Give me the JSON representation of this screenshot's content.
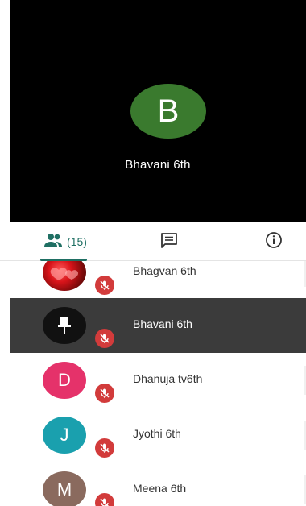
{
  "stage": {
    "avatar_letter": "B",
    "avatar_color": "#3a7a2e",
    "name": "Bhavani 6th"
  },
  "tabs": {
    "people_count": "(15)",
    "active": "people",
    "accent_color": "#1f6f63",
    "icons": [
      "people-icon",
      "chat-icon",
      "info-icon"
    ]
  },
  "participants": [
    {
      "name": "Bhagvan 6th",
      "avatar": "photo",
      "muted": true
    },
    {
      "name": "Bhavani 6th",
      "avatar": "pin-icon",
      "muted": true,
      "selected": true
    },
    {
      "name": "Dhanuja tv6th",
      "avatar_letter": "D",
      "avatar_color": "#e5326a",
      "muted": true
    },
    {
      "name": "Jyothi 6th",
      "avatar_letter": "J",
      "avatar_color": "#1aa0ae",
      "muted": true
    },
    {
      "name": "Meena 6th",
      "avatar_letter": "M",
      "avatar_color": "#8a6a5e",
      "muted": true
    }
  ],
  "colors": {
    "mute_badge": "#d23b3b",
    "selected_row": "#3b3b3b"
  }
}
